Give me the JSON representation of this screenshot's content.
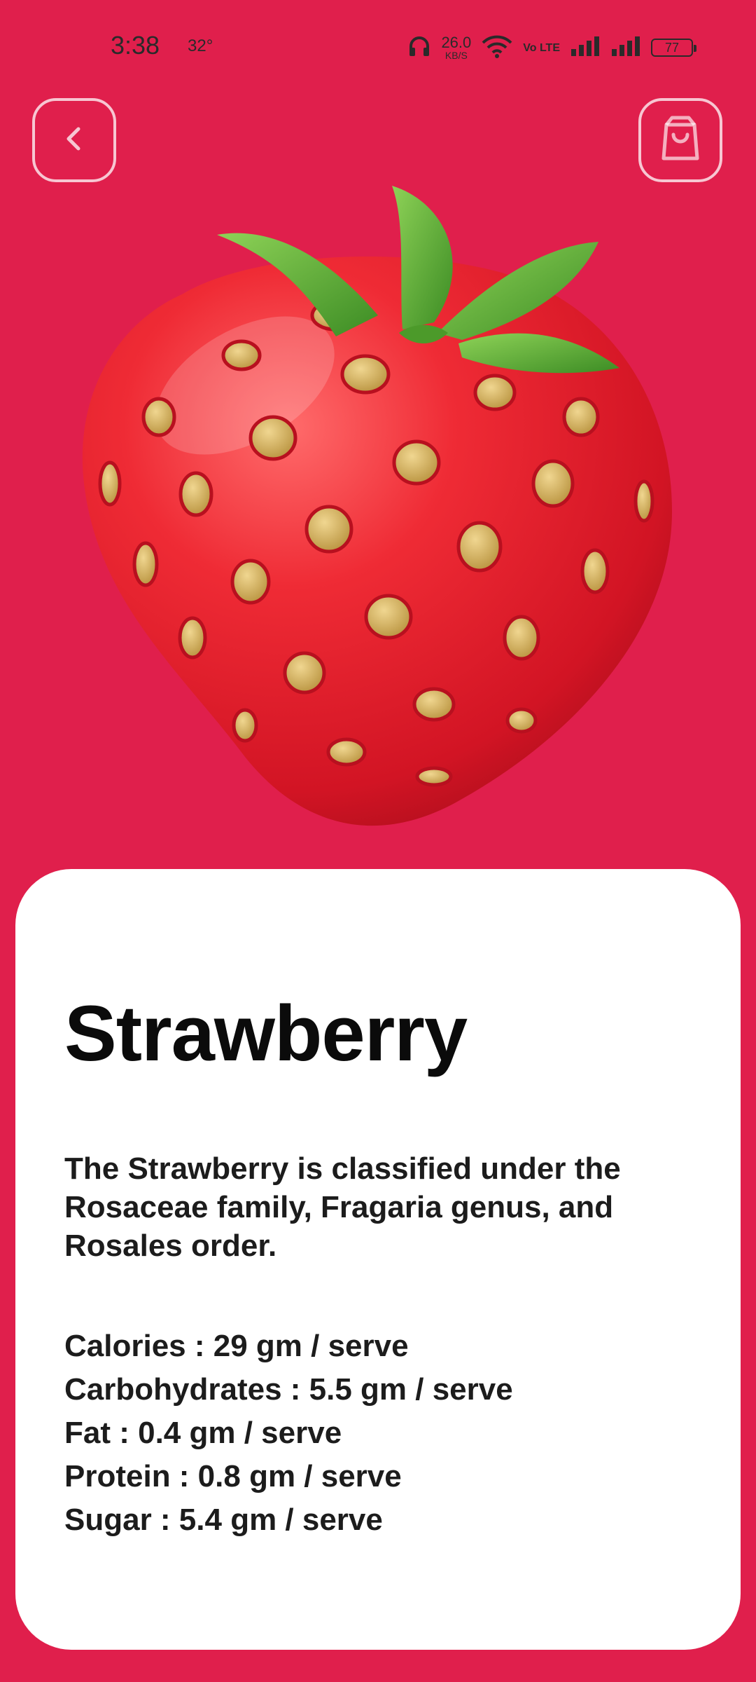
{
  "status_bar": {
    "time": "3:38",
    "temperature": "32°",
    "network_speed_value": "26.0",
    "network_speed_unit": "KB/S",
    "volte_label": "Vo LTE",
    "battery": "77",
    "icons": [
      "headphones-icon",
      "wifi-icon",
      "volte-icon",
      "signal-icon",
      "signal-icon",
      "battery-icon"
    ]
  },
  "nav": {
    "back_icon": "chevron-left-icon",
    "cart_icon": "shopping-bag-icon"
  },
  "product": {
    "name": "Strawberry",
    "description": "The Strawberry is classified under the Rosaceae family, Fragaria genus, and Rosales order.",
    "nutrition": [
      "Calories : 29 gm / serve",
      "Carbohydrates : 5.5 gm / serve",
      "Fat : 0.4 gm / serve",
      "Protein : 0.8 gm / serve",
      "Sugar : 5.4 gm / serve"
    ]
  },
  "colors": {
    "background": "#e01f4c",
    "card": "#ffffff",
    "strawberry": "#e5222e",
    "seed": "#d6b35f",
    "leaf": "#5ea832"
  }
}
